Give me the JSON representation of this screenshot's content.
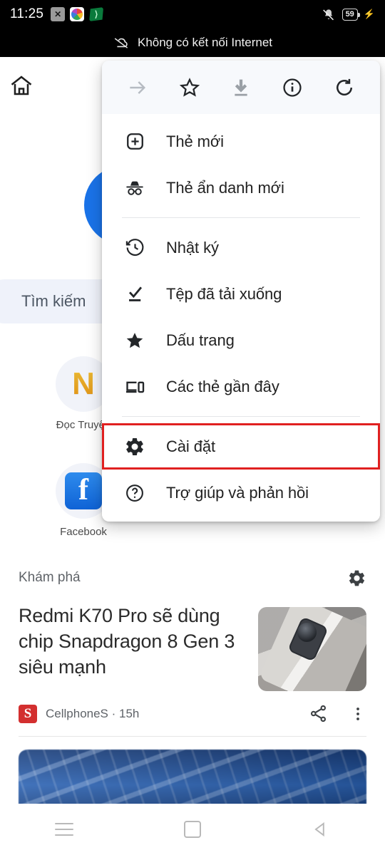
{
  "status_bar": {
    "clock": "11:25",
    "notification_icons": [
      "close-badge-icon",
      "color-wheel-icon",
      "green-app-icon"
    ],
    "battery_level": "59",
    "battery_charging": true,
    "ringer_icon": "bell-muted-icon",
    "offline_banner": "Không có kết nối Internet",
    "offline_icon": "cloud-off-icon",
    "background": "#000000"
  },
  "new_tab_page": {
    "home_icon": "home-icon",
    "search": {
      "value": "Tìm kiếm",
      "placeholder": "Tìm kiếm hoặc nhập địa chỉ web"
    },
    "shortcuts": [
      {
        "label": "Đọc Truyện",
        "icon": "letter-n-logo-icon"
      },
      {
        "label": "Facebook",
        "icon": "facebook-logo-icon"
      }
    ]
  },
  "discover": {
    "section_title": "Khám phá",
    "settings_icon": "gear-icon",
    "articles": [
      {
        "title": "Redmi K70 Pro sẽ dùng chip Snapdragon 8 Gen 3 siêu mạnh",
        "source": "CellphoneS",
        "time": "15h",
        "meta": "CellphoneS · 15h",
        "source_logo": "cellphones-s-logo-icon",
        "share_icon": "share-icon",
        "more_icon": "more-vertical-icon",
        "thumbnail": "silver-phone-photo"
      },
      {
        "title": "",
        "thumbnail": "blue-circuit-board-photo"
      }
    ]
  },
  "menu": {
    "header_actions": [
      {
        "name": "forward-icon",
        "label": "Tiến",
        "enabled": false
      },
      {
        "name": "star-icon",
        "label": "Dấu trang trang này",
        "enabled": true
      },
      {
        "name": "download-icon",
        "label": "Tải xuống trang",
        "enabled": false
      },
      {
        "name": "info-icon",
        "label": "Thông tin trang",
        "enabled": true
      },
      {
        "name": "reload-icon",
        "label": "Tải lại",
        "enabled": true
      }
    ],
    "items": [
      {
        "label": "Thẻ mới",
        "icon": "plus-box-icon",
        "highlighted": false
      },
      {
        "label": "Thẻ ẩn danh mới",
        "icon": "incognito-icon",
        "highlighted": false
      },
      {
        "label": "Nhật ký",
        "icon": "history-icon",
        "highlighted": false
      },
      {
        "label": "Tệp đã tải xuống",
        "icon": "download-check-icon",
        "highlighted": false
      },
      {
        "label": "Dấu trang",
        "icon": "star-filled-icon",
        "highlighted": false
      },
      {
        "label": "Các thẻ gần đây",
        "icon": "devices-icon",
        "highlighted": false
      },
      {
        "label": "Cài đặt",
        "icon": "gear-icon",
        "highlighted": true
      },
      {
        "label": "Trợ giúp và phản hồi",
        "icon": "help-circle-icon",
        "highlighted": false
      }
    ],
    "highlight_color": "#e02020"
  },
  "nav_bar": {
    "recents_label": "Gần đây",
    "home_label": "Trang chủ",
    "back_label": "Quay lại",
    "icons": [
      "menu-icon",
      "square-home-icon",
      "back-triangle-icon"
    ]
  }
}
